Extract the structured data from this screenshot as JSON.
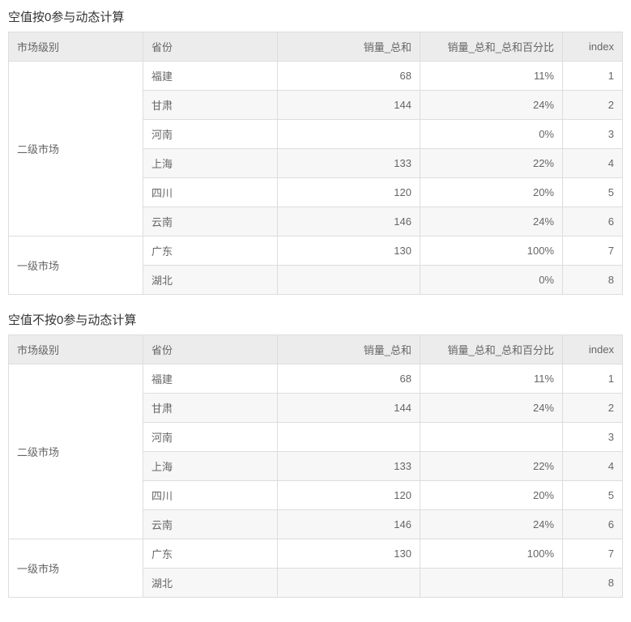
{
  "tables": [
    {
      "title": "空值按0参与动态计算",
      "headers": {
        "market": "市场级别",
        "province": "省份",
        "sum": "销量_总和",
        "pct": "销量_总和_总和百分比",
        "index": "index"
      },
      "groups": [
        {
          "market": "二级市场",
          "rows": [
            {
              "province": "福建",
              "sum": "68",
              "pct": "11%",
              "index": "1",
              "alt": false
            },
            {
              "province": "甘肃",
              "sum": "144",
              "pct": "24%",
              "index": "2",
              "alt": true
            },
            {
              "province": "河南",
              "sum": "",
              "pct": "0%",
              "index": "3",
              "alt": false
            },
            {
              "province": "上海",
              "sum": "133",
              "pct": "22%",
              "index": "4",
              "alt": true
            },
            {
              "province": "四川",
              "sum": "120",
              "pct": "20%",
              "index": "5",
              "alt": false
            },
            {
              "province": "云南",
              "sum": "146",
              "pct": "24%",
              "index": "6",
              "alt": true
            }
          ]
        },
        {
          "market": "一级市场",
          "rows": [
            {
              "province": "广东",
              "sum": "130",
              "pct": "100%",
              "index": "7",
              "alt": false
            },
            {
              "province": "湖北",
              "sum": "",
              "pct": "0%",
              "index": "8",
              "alt": true
            }
          ]
        }
      ]
    },
    {
      "title": "空值不按0参与动态计算",
      "headers": {
        "market": "市场级别",
        "province": "省份",
        "sum": "销量_总和",
        "pct": "销量_总和_总和百分比",
        "index": "index"
      },
      "groups": [
        {
          "market": "二级市场",
          "rows": [
            {
              "province": "福建",
              "sum": "68",
              "pct": "11%",
              "index": "1",
              "alt": false
            },
            {
              "province": "甘肃",
              "sum": "144",
              "pct": "24%",
              "index": "2",
              "alt": true
            },
            {
              "province": "河南",
              "sum": "",
              "pct": "",
              "index": "3",
              "alt": false
            },
            {
              "province": "上海",
              "sum": "133",
              "pct": "22%",
              "index": "4",
              "alt": true
            },
            {
              "province": "四川",
              "sum": "120",
              "pct": "20%",
              "index": "5",
              "alt": false
            },
            {
              "province": "云南",
              "sum": "146",
              "pct": "24%",
              "index": "6",
              "alt": true
            }
          ]
        },
        {
          "market": "一级市场",
          "rows": [
            {
              "province": "广东",
              "sum": "130",
              "pct": "100%",
              "index": "7",
              "alt": false
            },
            {
              "province": "湖北",
              "sum": "",
              "pct": "",
              "index": "8",
              "alt": true
            }
          ]
        }
      ]
    }
  ]
}
